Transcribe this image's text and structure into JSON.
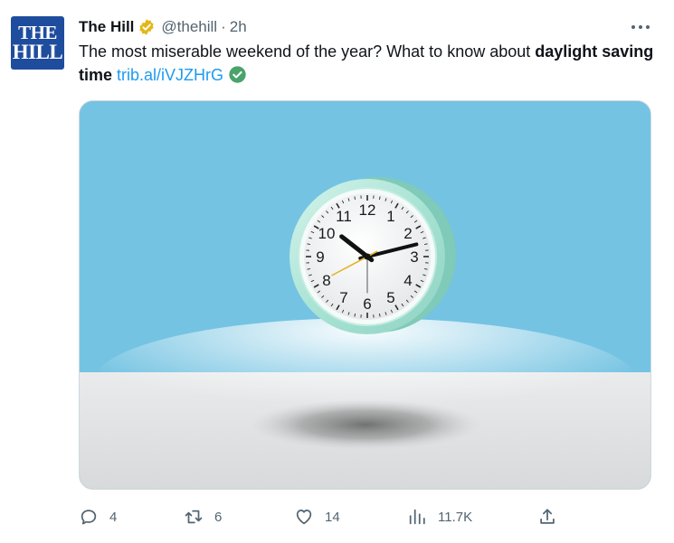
{
  "account": {
    "name": "The Hill",
    "handle": "@thehill",
    "separator": "·",
    "time": "2h",
    "avatar_line1": "THE",
    "avatar_line2": "HILL",
    "verified_badge_color": "#e2b719"
  },
  "post": {
    "text_before": "The most miserable weekend of the year? What to know about ",
    "text_bold": "daylight saving time",
    "link": "trib.al/iVJZHrG",
    "link_color": "#1d9bf0",
    "link_check_color": "#4aa36b"
  },
  "media": {
    "image_name": "alarm clock floating above shadow on light blue background",
    "clock_numbers": [
      "12",
      "1",
      "2",
      "3",
      "4",
      "5",
      "6",
      "7",
      "8",
      "9",
      "10",
      "11"
    ],
    "sky_color": "#74c3e2",
    "frame_color": "#a8e3d4"
  },
  "actions": {
    "reply_icon": "reply-icon",
    "reply_count": "4",
    "repost_icon": "repost-icon",
    "repost_count": "6",
    "like_icon": "heart-icon",
    "like_count": "14",
    "views_icon": "views-icon",
    "views_count": "11.7K",
    "share_icon": "share-icon"
  }
}
